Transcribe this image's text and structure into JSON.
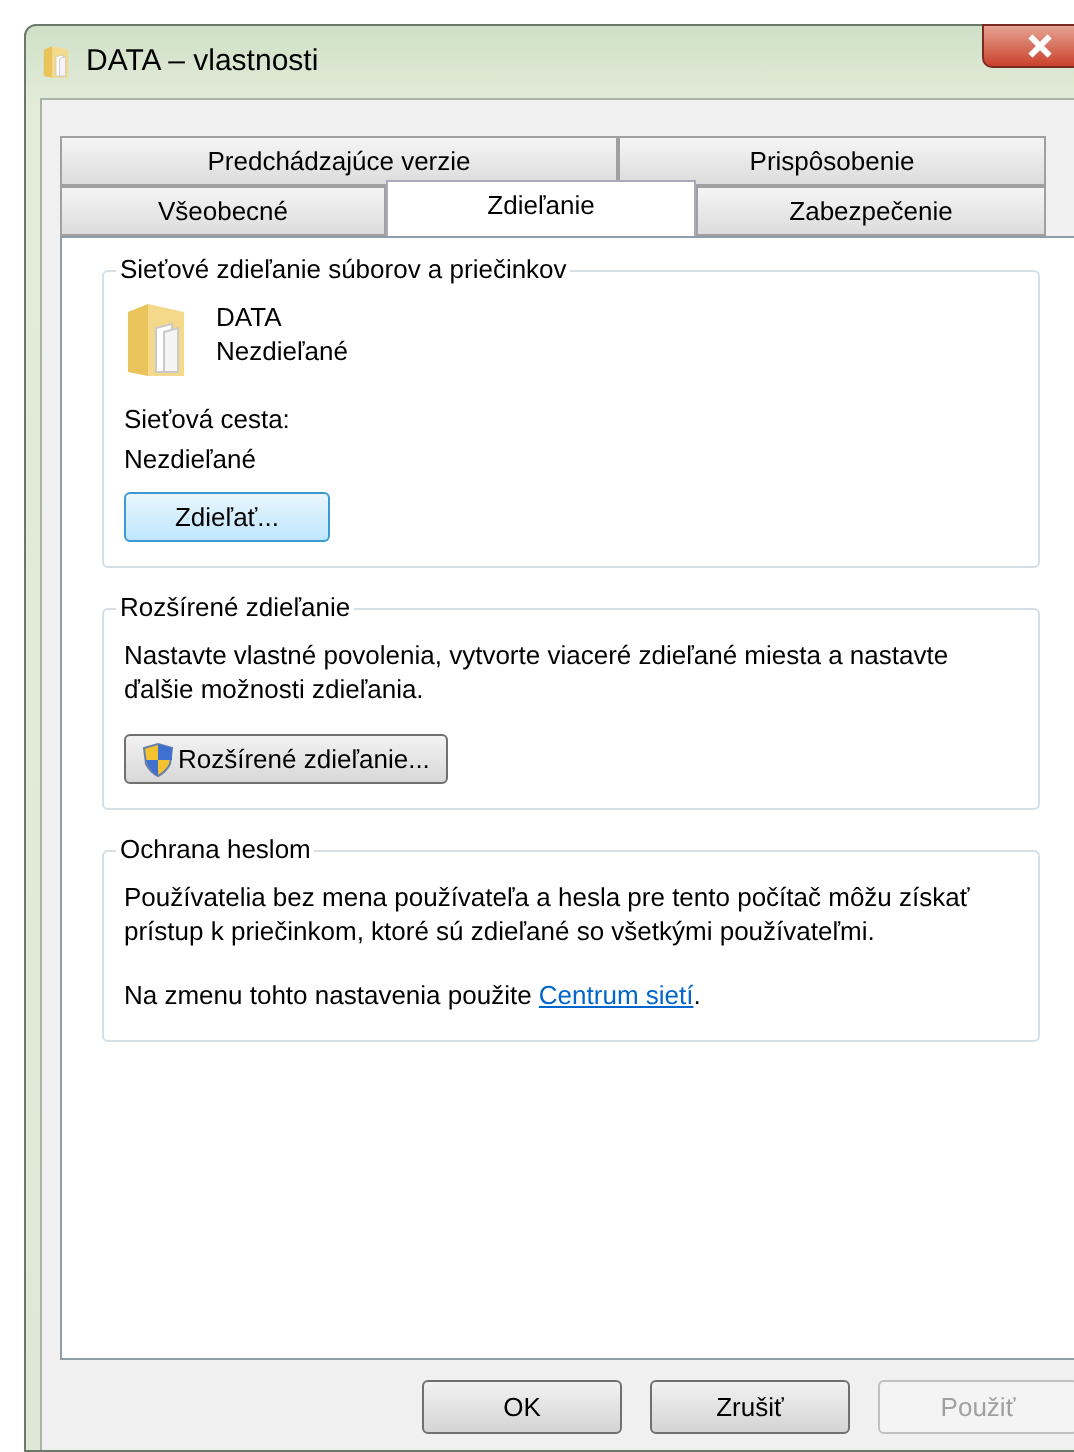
{
  "window": {
    "title": "DATA – vlastnosti"
  },
  "tab_rows": [
    [
      {
        "label": "Predchádzajúce verzie",
        "selected": false
      },
      {
        "label": "Prispôsobenie",
        "selected": false
      }
    ],
    [
      {
        "label": "Všeobecné",
        "selected": false
      },
      {
        "label": "Zdieľanie",
        "selected": true
      },
      {
        "label": "Zabezpečenie",
        "selected": false
      }
    ]
  ],
  "network_sharing": {
    "title": "Sieťové zdieľanie súborov a priečinkov",
    "folder_name": "DATA",
    "folder_status": "Nezdieľané",
    "path_label": "Sieťová cesta:",
    "path_value": "Nezdieľané",
    "button": "Zdieľať..."
  },
  "advanced_sharing": {
    "title": "Rozšírené zdieľanie",
    "description": "Nastavte vlastné povolenia, vytvorte viaceré zdieľané miesta a nastavte ďalšie možnosti zdieľania.",
    "button": "Rozšírené zdieľanie..."
  },
  "password_protection": {
    "title": "Ochrana heslom",
    "description": "Používatelia bez mena používateľa a hesla pre tento počítač môžu získať prístup k priečinkom, ktoré sú zdieľané so všetkými používateľmi.",
    "note": "Na zmenu tohto nastavenia použite ",
    "link": "Centrum sietí",
    "note_end": "."
  },
  "buttons": [
    {
      "label": "OK",
      "disabled": false
    },
    {
      "label": "Zrušiť",
      "disabled": false
    },
    {
      "label": "Použiť",
      "disabled": true
    }
  ]
}
